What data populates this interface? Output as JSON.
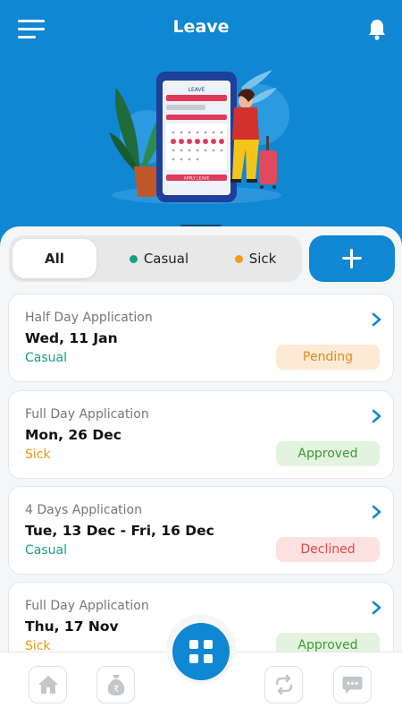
{
  "header": {
    "title": "Leave",
    "menu_icon": "hamburger-menu-icon",
    "notification_icon": "bell-icon",
    "background_color": "#0f87d3"
  },
  "illustration": {
    "phone_header": "LEAVE",
    "phone_button": "APPLY LEAVE"
  },
  "filters": {
    "items": [
      {
        "label": "All",
        "active": true
      },
      {
        "label": "Casual",
        "dot_color": "#16a085"
      },
      {
        "label": "Sick",
        "dot_color": "#f39c12"
      }
    ]
  },
  "add_button": {
    "icon": "plus-icon"
  },
  "leaves": [
    {
      "type": "Half Day Application",
      "date": "Wed, 11 Jan",
      "category": "Casual",
      "status": "Pending"
    },
    {
      "type": "Full Day Application",
      "date": "Mon, 26 Dec",
      "category": "Sick",
      "status": "Approved"
    },
    {
      "type": "4 Days Application",
      "date": "Tue, 13 Dec - Fri, 16 Dec",
      "category": "Casual",
      "status": "Declined"
    },
    {
      "type": "Full Day Application",
      "date": "Thu, 17 Nov",
      "category": "Sick",
      "status": "Approved"
    }
  ],
  "colors": {
    "casual": "#16a085",
    "sick": "#e89a0c",
    "pending_text": "#e68a1c",
    "pending_bg": "#fcead5",
    "approved_text": "#3f9a34",
    "approved_bg": "#e3f3df",
    "declined_text": "#e04848",
    "declined_bg": "#fde1e1"
  },
  "bottom_nav": {
    "items": [
      "home-icon",
      "rupee-bag-icon",
      "grid-icon",
      "swap-icon",
      "chat-icon"
    ]
  }
}
